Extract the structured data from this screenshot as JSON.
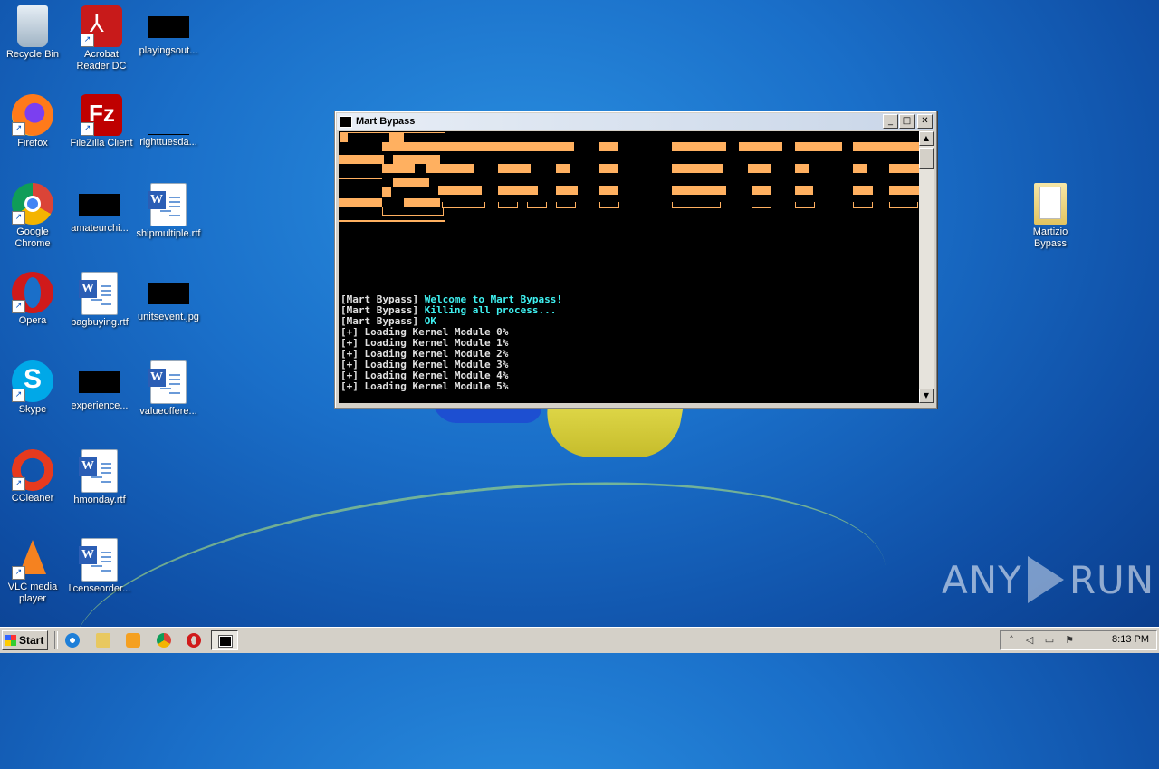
{
  "desktop": {
    "icons_left": [
      {
        "label": "Recycle Bin",
        "icon": "recycle-bin-icon"
      },
      {
        "label": "Acrobat Reader DC",
        "icon": "acrobat-icon"
      },
      {
        "label": "playingsout...",
        "icon": "black-thumbnail-icon"
      },
      {
        "label": "Firefox",
        "icon": "firefox-icon"
      },
      {
        "label": "FileZilla Client",
        "icon": "filezilla-icon"
      },
      {
        "label": "righttuesda...",
        "icon": "file-icon"
      },
      {
        "label": "Google Chrome",
        "icon": "chrome-icon"
      },
      {
        "label": "amateurchi...",
        "icon": "black-thumbnail-icon"
      },
      {
        "label": "shipmultiple.rtf",
        "icon": "word-doc-icon"
      },
      {
        "label": "Opera",
        "icon": "opera-icon"
      },
      {
        "label": "bagbuying.rtf",
        "icon": "word-doc-icon"
      },
      {
        "label": "unitsevent.jpg",
        "icon": "black-thumbnail-icon"
      },
      {
        "label": "Skype",
        "icon": "skype-icon"
      },
      {
        "label": "experience...",
        "icon": "black-thumbnail-icon"
      },
      {
        "label": "valueoffere...",
        "icon": "word-doc-icon"
      },
      {
        "label": "CCleaner",
        "icon": "ccleaner-icon"
      },
      {
        "label": "hmonday.rtf",
        "icon": "word-doc-icon"
      },
      {
        "label": "VLC media player",
        "icon": "vlc-icon"
      },
      {
        "label": "licenseorder...",
        "icon": "word-doc-icon"
      }
    ],
    "folder_right": {
      "label": "Martizio Bypass",
      "icon": "folder-icon"
    },
    "watermark_left": "ANY",
    "watermark_right": "RUN"
  },
  "window": {
    "title": "Mart Bypass",
    "minimize": "_",
    "maximize": "□",
    "close": "✕",
    "console": {
      "messages": [
        {
          "prefix": "[Mart Bypass]",
          "text": " Welcome to Mart Bypass!"
        },
        {
          "prefix": "[Mart Bypass]",
          "text": " Killing all process..."
        },
        {
          "prefix": "[Mart Bypass]",
          "text": " OK"
        }
      ],
      "loading": [
        "[+] Loading Kernel Module 0%",
        "[+] Loading Kernel Module 1%",
        "[+] Loading Kernel Module 2%",
        "[+] Loading Kernel Module 3%",
        "[+] Loading Kernel Module 4%",
        "[+] Loading Kernel Module 5%"
      ]
    }
  },
  "taskbar": {
    "start_label": "Start",
    "clock": "8:13 PM",
    "tray_expand": "˄",
    "quicklaunch": [
      "ie-icon",
      "explorer-icon",
      "media-player-icon",
      "chrome-icon",
      "opera-icon"
    ]
  },
  "colors": {
    "banner": "#ffb060",
    "console_bg": "#000000",
    "message_text": "#3ff0f0"
  }
}
